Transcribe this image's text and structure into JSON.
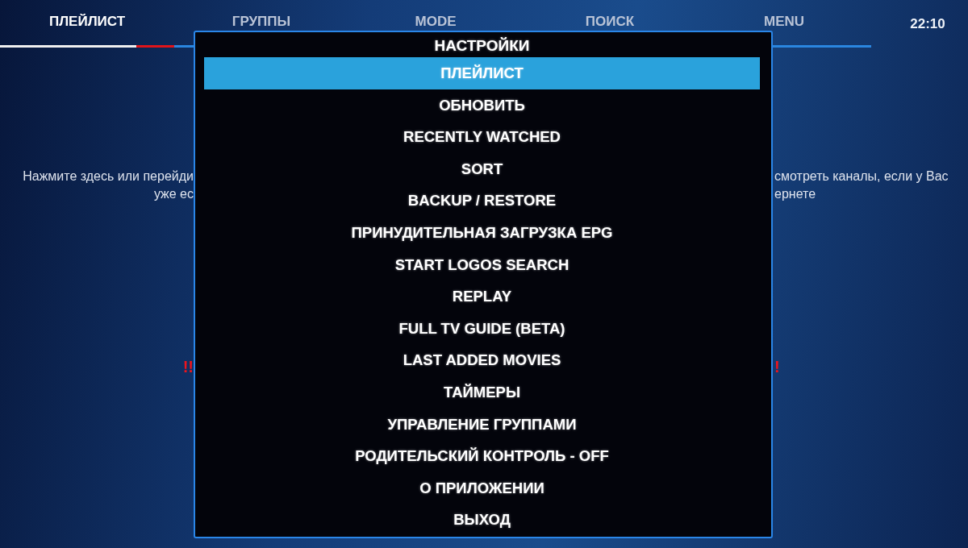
{
  "tabs": [
    {
      "label": "ПЛЕЙЛИСТ",
      "selected": true
    },
    {
      "label": "ГРУППЫ",
      "selected": false
    },
    {
      "label": "MODE",
      "selected": false
    },
    {
      "label": "ПОИСК",
      "selected": false
    },
    {
      "label": "MENU",
      "selected": false
    }
  ],
  "clock": "22:10",
  "info": {
    "lines": [
      {
        "kind": "text",
        "left": "Нажмите здесь или перейди",
        "right": "смотреть каналы, если у Вас"
      },
      {
        "kind": "text",
        "left": "уже ес",
        "right": "ернете"
      },
      {
        "kind": "warning",
        "left": "!!",
        "right": "!"
      }
    ]
  },
  "menu": {
    "title": "НАСТРОЙКИ",
    "items": [
      {
        "label": "ПЛЕЙЛИСТ",
        "selected": true
      },
      {
        "label": "ОБНОВИТЬ",
        "selected": false
      },
      {
        "label": "RECENTLY WATCHED",
        "selected": false
      },
      {
        "label": "SORT",
        "selected": false
      },
      {
        "label": "BACKUP / RESTORE",
        "selected": false
      },
      {
        "label": "ПРИНУДИТЕЛЬНАЯ ЗАГРУЗКА EPG",
        "selected": false
      },
      {
        "label": "START LOGOS SEARCH",
        "selected": false
      },
      {
        "label": "REPLAY",
        "selected": false
      },
      {
        "label": "FULL TV GUIDE (BETA)",
        "selected": false
      },
      {
        "label": "LAST ADDED MOVIES",
        "selected": false
      },
      {
        "label": "ТАЙМЕРЫ",
        "selected": false
      },
      {
        "label": "УПРАВЛЕНИЕ ГРУППАМИ",
        "selected": false
      },
      {
        "label": "РОДИТЕЛЬСКИЙ КОНТРОЛЬ - OFF",
        "selected": false
      },
      {
        "label": "О ПРИЛОЖЕНИИ",
        "selected": false
      },
      {
        "label": "ВЫХОД",
        "selected": false
      }
    ]
  }
}
